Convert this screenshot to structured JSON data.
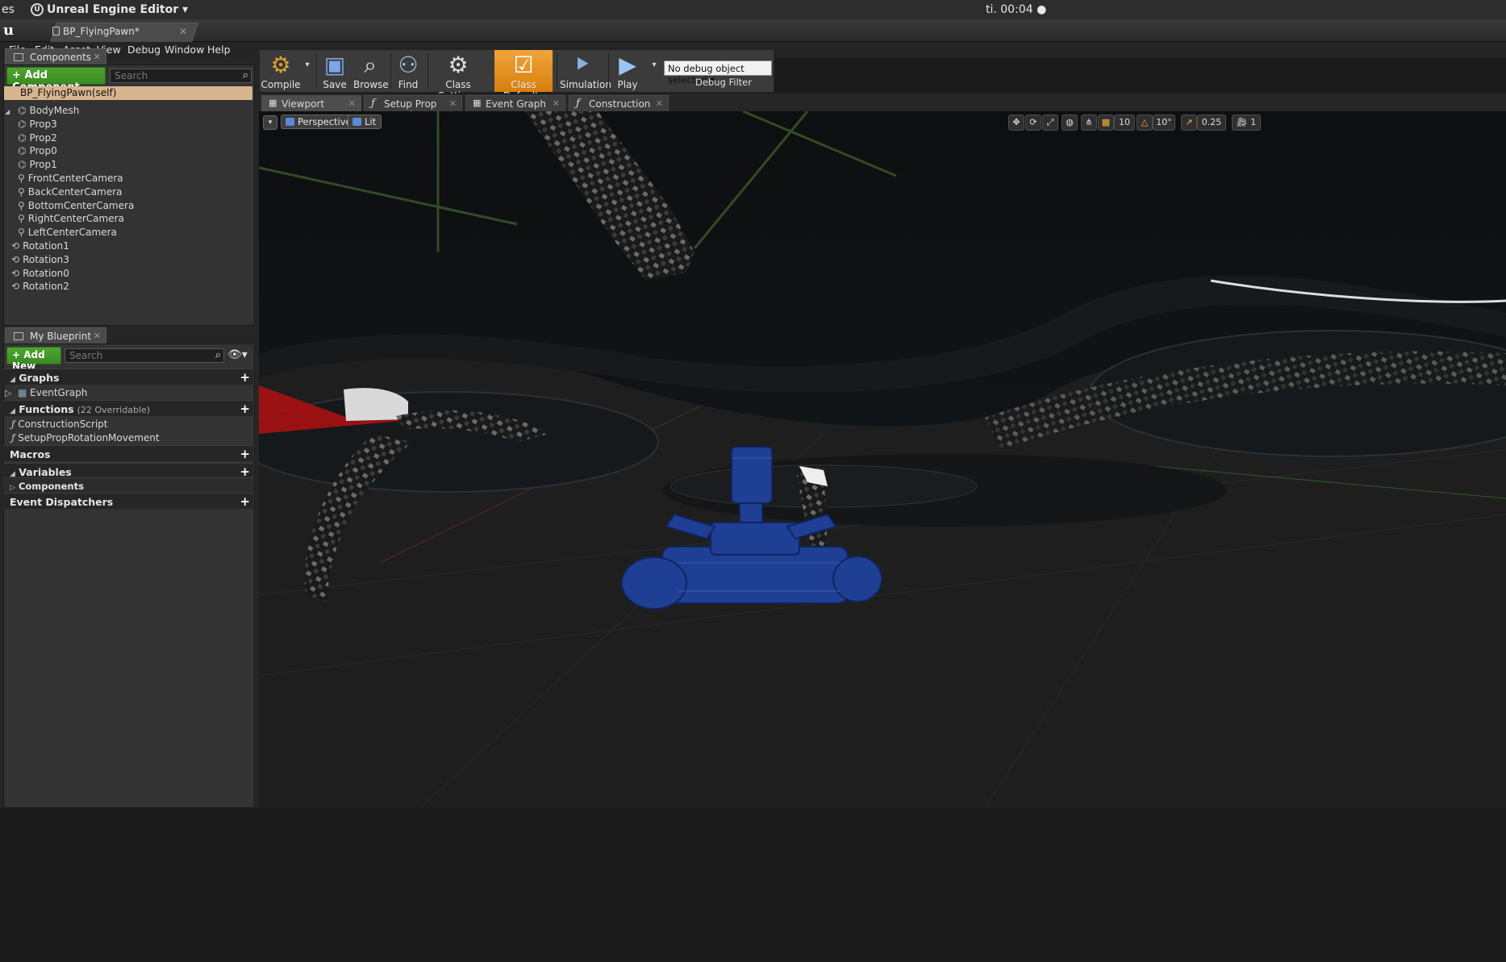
{
  "os_bar": {
    "left_fragment": "es",
    "app_name": "Unreal Engine Editor",
    "clock": "ti. 00:04"
  },
  "doc_tab": {
    "title": "BP_FlyingPawn*"
  },
  "menu": [
    "File",
    "Edit",
    "Asset",
    "View",
    "Debug",
    "Window",
    "Help"
  ],
  "components_panel": {
    "tab_label": "Components",
    "add_button": "+ Add Component",
    "search_placeholder": "Search",
    "self_row": "BP_FlyingPawn(self)",
    "tree": [
      {
        "label": "BodyMesh",
        "depth": 0,
        "expanded": true
      },
      {
        "label": "Prop3",
        "depth": 1
      },
      {
        "label": "Prop2",
        "depth": 1
      },
      {
        "label": "Prop0",
        "depth": 1
      },
      {
        "label": "Prop1",
        "depth": 1
      },
      {
        "label": "FrontCenterCamera",
        "depth": 1
      },
      {
        "label": "BackCenterCamera",
        "depth": 1
      },
      {
        "label": "BottomCenterCamera",
        "depth": 1
      },
      {
        "label": "RightCenterCamera",
        "depth": 1
      },
      {
        "label": "LeftCenterCamera",
        "depth": 1
      },
      {
        "label": "Rotation1",
        "depth": 0
      },
      {
        "label": "Rotation3",
        "depth": 0
      },
      {
        "label": "Rotation0",
        "depth": 0
      },
      {
        "label": "Rotation2",
        "depth": 0
      }
    ]
  },
  "blueprint_panel": {
    "tab_label": "My Blueprint",
    "add_button": "+ Add New",
    "search_placeholder": "Search",
    "sections": {
      "graphs": "Graphs",
      "event_graph": "EventGraph",
      "functions": "Functions",
      "functions_sub": "(22 Overridable)",
      "construction_script": "ConstructionScript",
      "setup_prop": "SetupPropRotationMovement",
      "macros": "Macros",
      "variables": "Variables",
      "components": "Components",
      "event_dispatchers": "Event Dispatchers"
    }
  },
  "toolbar": {
    "compile": "Compile",
    "save": "Save",
    "browse": "Browse",
    "find": "Find",
    "class_settings": "Class Settings",
    "class_defaults": "Class Defaults",
    "simulation": "Simulation",
    "play": "Play",
    "debug_select": "No debug object selected",
    "debug_filter": "Debug Filter"
  },
  "editor_tabs": [
    "Viewport",
    "Setup Prop Rotatic",
    "Event Graph",
    "Construction Scrip"
  ],
  "viewport": {
    "perspective": "Perspective",
    "lit": "Lit",
    "grid_snap": "10",
    "rotation_snap": "10°",
    "scale_snap": "0.25",
    "camera_speed": "1"
  },
  "colors": {
    "accent_orange": "#e8951f",
    "green_button": "#46a02c",
    "self_row": "#d7b58f",
    "drone_blue": "#1e3a8a"
  }
}
